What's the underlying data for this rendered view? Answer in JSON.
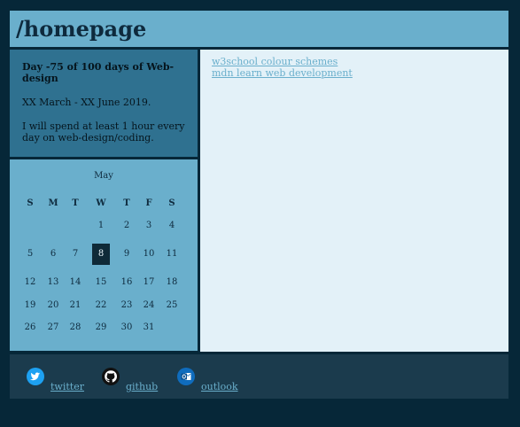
{
  "header": {
    "title": "/homepage"
  },
  "progress": {
    "title": "Day   -75   of 100 days of Web-design",
    "dates": "XX March - XX June 2019.",
    "goal": "I will spend at least 1 hour every day on web-design/coding."
  },
  "calendar": {
    "month": "May",
    "weekdays": [
      "S",
      "M",
      "T",
      "W",
      "T",
      "F",
      "S"
    ],
    "today": "8",
    "weeks": [
      [
        "",
        "",
        "",
        "1",
        "2",
        "3",
        "4"
      ],
      [
        "5",
        "6",
        "7",
        "8",
        "9",
        "10",
        "11"
      ],
      [
        "12",
        "13",
        "14",
        "15",
        "16",
        "17",
        "18"
      ],
      [
        "19",
        "20",
        "21",
        "22",
        "23",
        "24",
        "25"
      ],
      [
        "26",
        "27",
        "28",
        "29",
        "30",
        "31",
        ""
      ]
    ]
  },
  "main": {
    "links": [
      {
        "label": "w3school colour schemes"
      },
      {
        "label": "mdn learn web development"
      }
    ]
  },
  "footer": {
    "social": [
      {
        "label": "twitter",
        "icon": "twitter-icon",
        "color": "#1da1f2"
      },
      {
        "label": "github",
        "icon": "github-icon",
        "color": "#111111"
      },
      {
        "label": "outlook",
        "icon": "outlook-icon",
        "color": "#0f6cbd"
      }
    ]
  }
}
